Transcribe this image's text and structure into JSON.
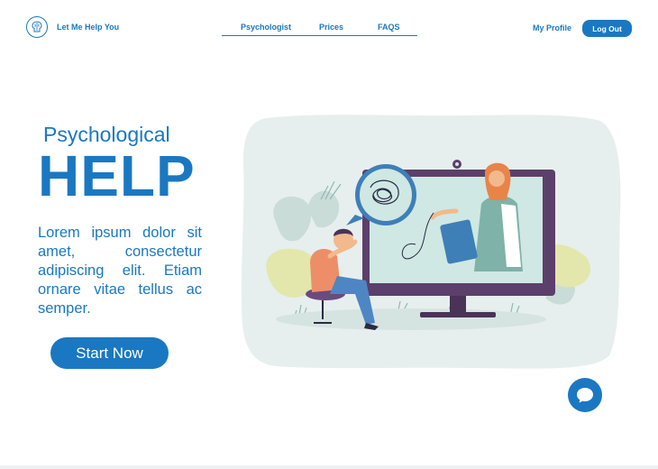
{
  "header": {
    "brand": "Let Me Help You",
    "logo_icon": "brain-icon",
    "nav": [
      "Psychologist",
      "Prices",
      "FAQS"
    ],
    "profile": "My Profile",
    "logout": "Log Out"
  },
  "hero": {
    "subtitle": "Psychological",
    "title": "HELP",
    "body": "Lorem ipsum dolor sit amet, consectetur adipiscing elit. Etiam ornare vitae tellus ac semper.",
    "cta": "Start Now"
  },
  "chat": {
    "icon": "chat-bubble-icon"
  },
  "colors": {
    "primary": "#1a78c2",
    "panel": "#e6efee",
    "monitor": "#5c3f6a"
  }
}
